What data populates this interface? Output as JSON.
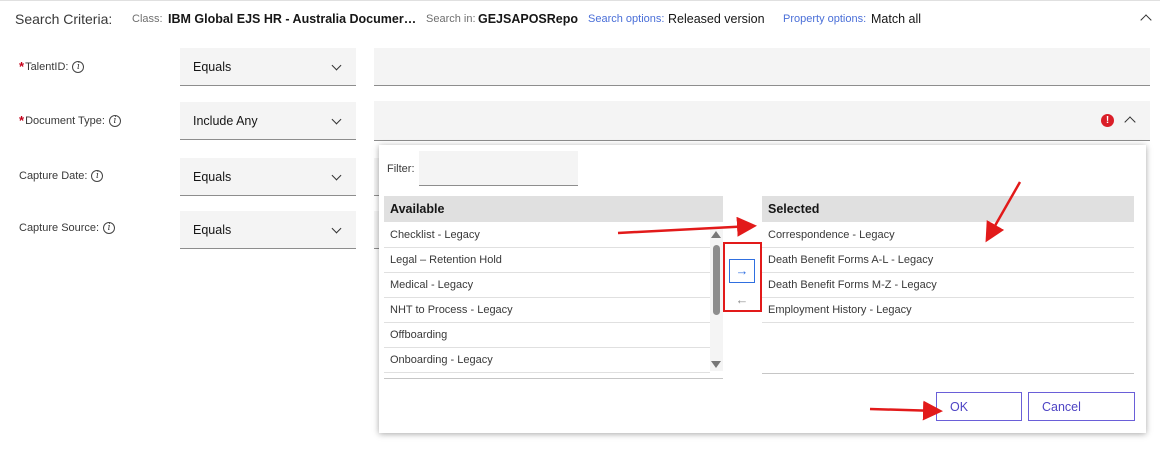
{
  "header": {
    "title": "Search Criteria:",
    "class_label": "Class:",
    "class_value": "IBM Global EJS HR - Australia Documer…",
    "search_in_label": "Search in:",
    "search_in_value": "GEJSAPOSRepo",
    "search_options_label": "Search options:",
    "search_options_value": "Released version",
    "property_options_label": "Property options:",
    "property_options_value": "Match all"
  },
  "fields": [
    {
      "label": "TalentID:",
      "required": true,
      "operator": "Equals",
      "value": ""
    },
    {
      "label": "Document Type:",
      "required": true,
      "operator": "Include Any",
      "value": ""
    },
    {
      "label": "Capture Date:",
      "required": false,
      "operator": "Equals",
      "value": ""
    },
    {
      "label": "Capture Source:",
      "required": false,
      "operator": "Equals",
      "value": ""
    }
  ],
  "popup": {
    "filter_label": "Filter:",
    "filter_value": "",
    "available_header": "Available",
    "selected_header": "Selected",
    "available_items": [
      "Checklist - Legacy",
      "Legal – Retention Hold",
      "Medical - Legacy",
      "NHT to Process - Legacy",
      "Offboarding",
      "Onboarding - Legacy"
    ],
    "selected_items": [
      "Correspondence - Legacy",
      "Death Benefit Forms A-L - Legacy",
      "Death Benefit Forms M-Z - Legacy",
      "Employment History - Legacy"
    ],
    "add_arrow": "→",
    "remove_arrow": "←",
    "ok_label": "OK",
    "cancel_label": "Cancel"
  },
  "colors": {
    "annotation_red": "#e21a1a",
    "accent_blue": "#2f6fe0",
    "button_purple": "#6a5fd8",
    "error_red": "#da1e28"
  }
}
